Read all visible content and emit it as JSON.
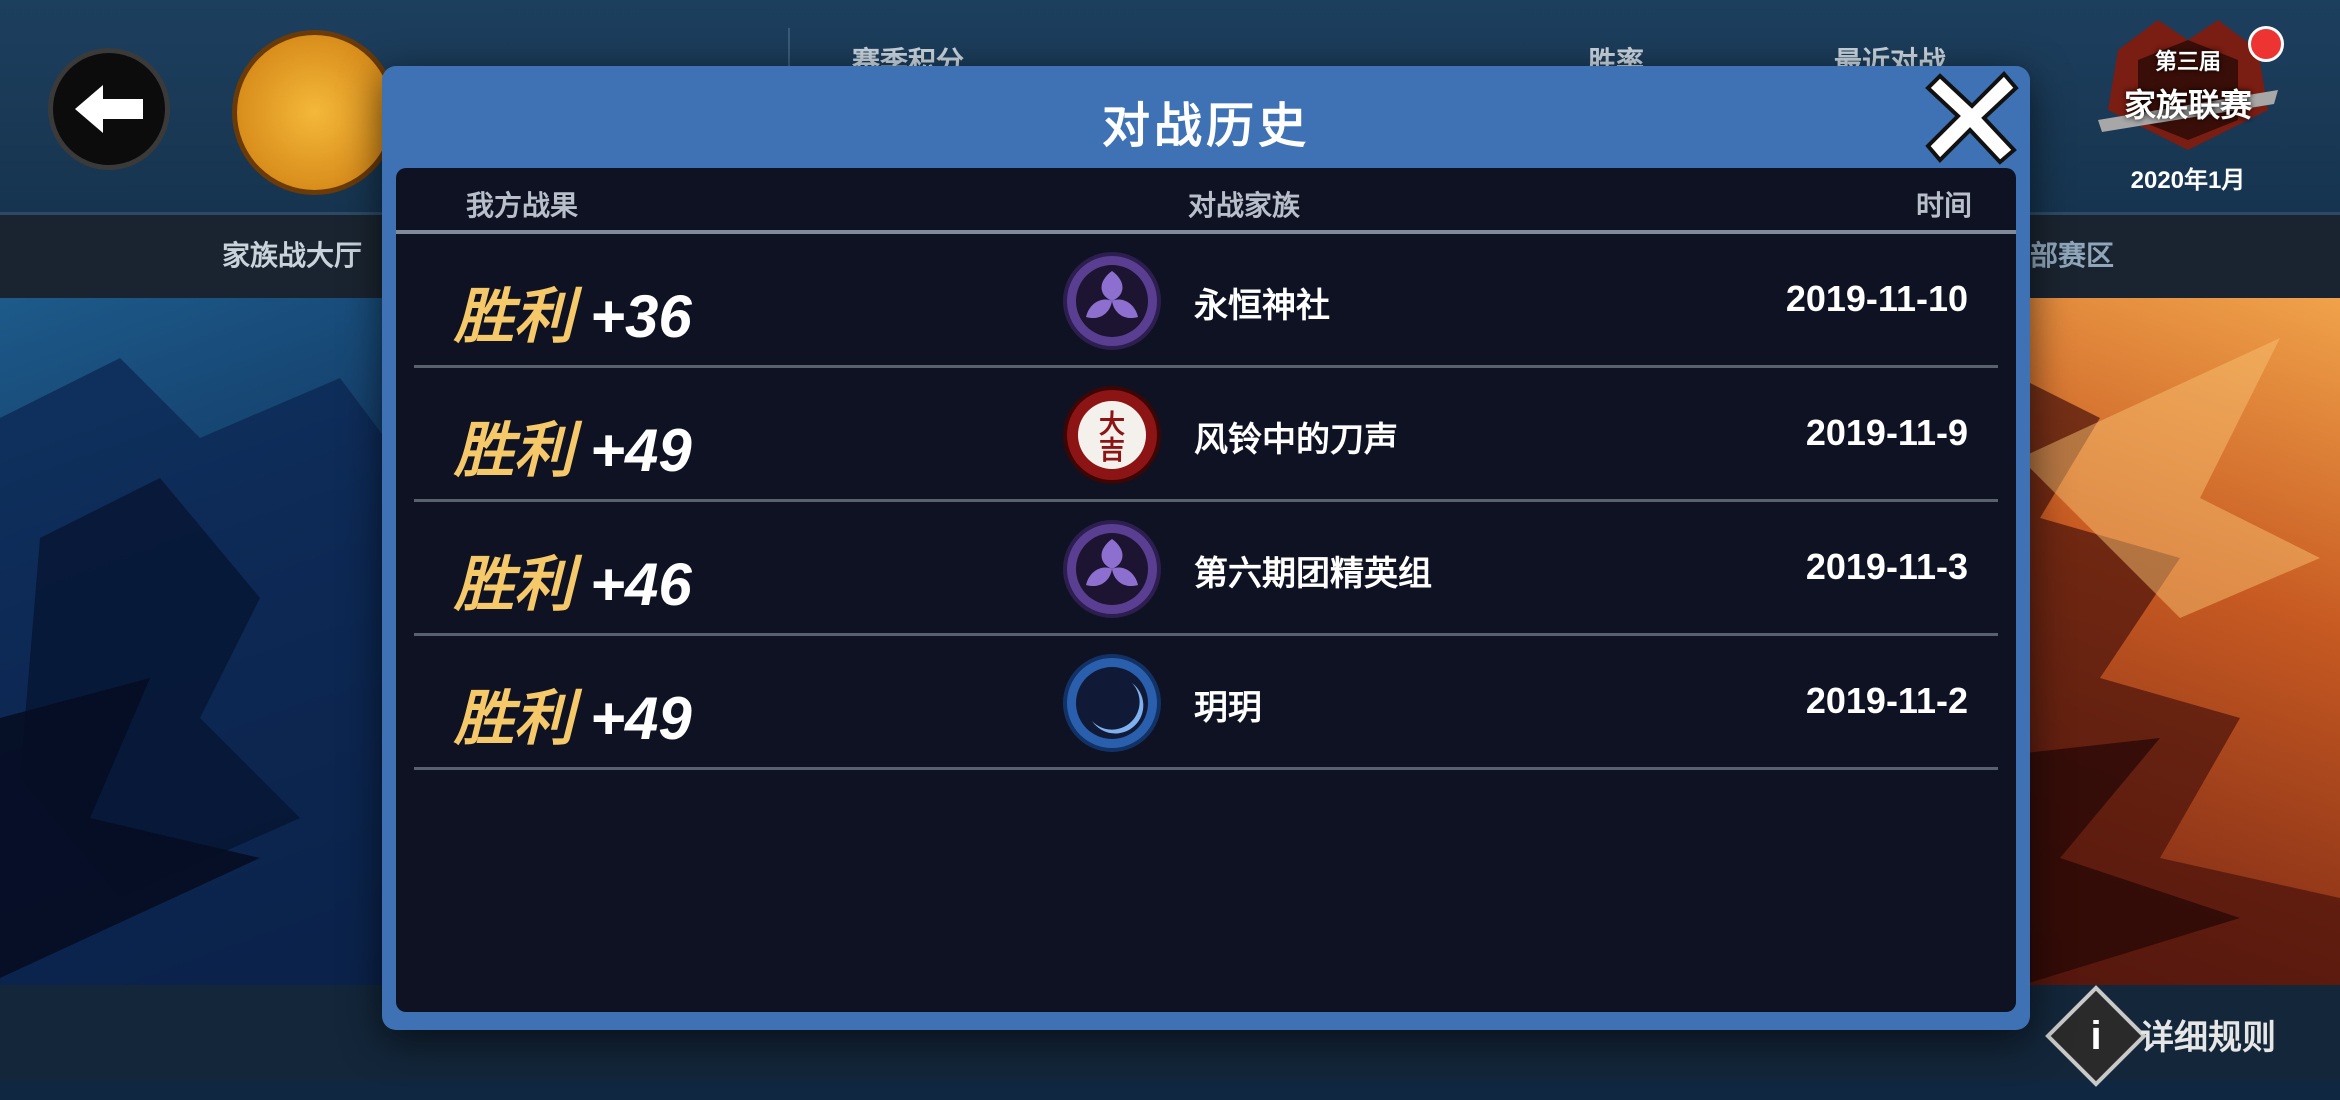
{
  "topbar": {
    "left_tab_label": "家族战大厅",
    "season_points_label": "赛季积分",
    "win_rate_label": "胜率",
    "recent_battles_label": "最近对战",
    "right_tab_label": "部赛区"
  },
  "league_badge": {
    "edition": "第三届",
    "title": "家族联赛",
    "date": "2020年1月"
  },
  "footer": {
    "info_icon": "i",
    "rules_label": "详细规则"
  },
  "modal": {
    "title": "对战历史",
    "columns": {
      "result": "我方战果",
      "opponent": "对战家族",
      "time": "时间"
    },
    "rows": [
      {
        "result": "胜利",
        "score": "+36",
        "clan_name": "永恒神社",
        "clan_icon": "purple-tomoe-emblem-icon",
        "date": "2019-11-10"
      },
      {
        "result": "胜利",
        "score": "+49",
        "clan_name": "风铃中的刀声",
        "clan_icon": "daikichi-emblem-icon",
        "date": "2019-11-9"
      },
      {
        "result": "胜利",
        "score": "+46",
        "clan_name": "第六期团精英组",
        "clan_icon": "purple-tomoe-emblem-icon",
        "date": "2019-11-3"
      },
      {
        "result": "胜利",
        "score": "+49",
        "clan_name": "玥玥",
        "clan_icon": "blue-crescent-emblem-icon",
        "date": "2019-11-2"
      }
    ],
    "daikichi_text_top": "大",
    "daikichi_text_bottom": "吉"
  },
  "colors": {
    "modal_frame": "#3f72b4",
    "modal_inner": "#0f1222",
    "win_gold": "#f5c86a",
    "purple_emblem": "#6b4aa8",
    "red_emblem": "#8c1414",
    "blue_emblem": "#3a6ec6"
  }
}
